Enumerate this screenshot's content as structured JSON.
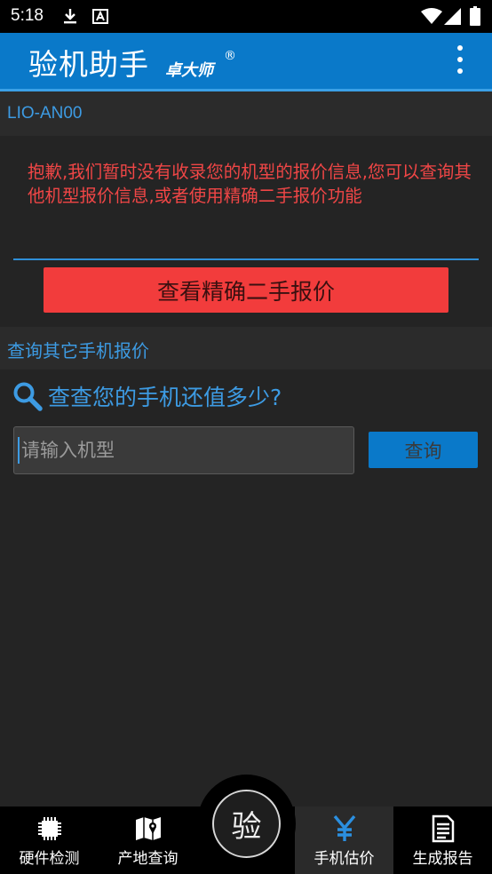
{
  "status_bar": {
    "time": "5:18",
    "icons": [
      "download-icon",
      "a-notification-icon",
      "wifi-icon",
      "signal-icon",
      "battery-icon"
    ]
  },
  "app_bar": {
    "title": "验机助手",
    "subtitle": "卓大师",
    "registered_mark": "®",
    "menu_icon": "more-vert-icon",
    "color": "#0a79c9"
  },
  "model_section": {
    "model_name": "LIO-AN00",
    "apology_text": "抱歉,我们暂时没有收录您的机型的报价信息,您可以查询其他机型报价信息,或者使用精确二手报价功能",
    "precise_quote_button": "查看精确二手报价",
    "alert_color": "#f04646"
  },
  "other_section": {
    "header": "查询其它手机报价",
    "search_title": "查查您的手机还值多少?",
    "input_placeholder": "请输入机型",
    "input_value": "",
    "query_button": "查询"
  },
  "bottom_nav": {
    "items": [
      {
        "label": "硬件检测",
        "icon": "chip-icon"
      },
      {
        "label": "产地查询",
        "icon": "map-icon"
      },
      {
        "label": "手机估价",
        "icon": "yen-icon",
        "active": true
      },
      {
        "label": "生成报告",
        "icon": "report-icon"
      }
    ],
    "center_button": "验"
  }
}
